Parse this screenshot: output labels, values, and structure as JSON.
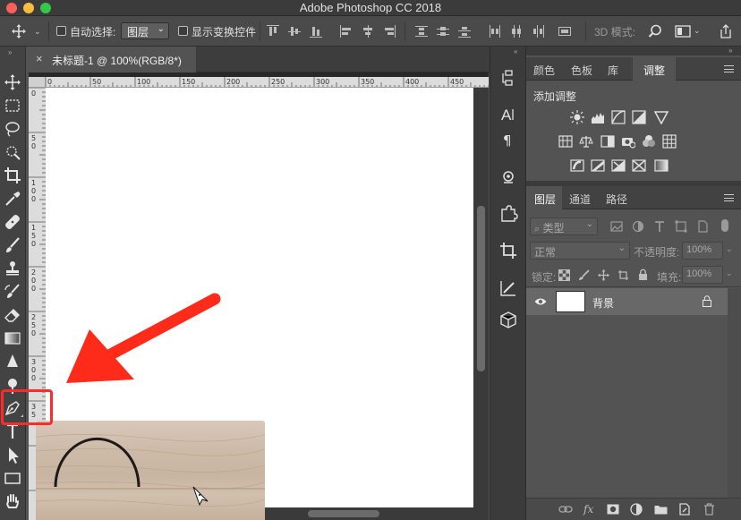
{
  "window": {
    "title": "Adobe Photoshop CC 2018"
  },
  "optionsbar": {
    "auto_select_label": "自动选择:",
    "auto_select_value": "图层",
    "show_transform_label": "显示变换控件",
    "mode_3d_label": "3D 模式:"
  },
  "document_tab": {
    "label": "未标题-1 @ 100%(RGB/8*)",
    "close_icon": "×"
  },
  "rulers": {
    "horizontal": [
      "0",
      "50",
      "100",
      "150",
      "200",
      "250",
      "300",
      "350",
      "400",
      "450"
    ],
    "vertical": [
      "0",
      "50",
      "100",
      "150",
      "200",
      "250",
      "300",
      "35"
    ]
  },
  "panel_top": {
    "tabs": [
      "颜色",
      "色板",
      "库",
      "调整"
    ],
    "active_tab": "调整",
    "add_adjustment_label": "添加调整"
  },
  "panel_layers": {
    "tabs": [
      "图层",
      "通道",
      "路径"
    ],
    "active_tab": "图层",
    "filter_label": "类型",
    "blend_mode": "正常",
    "opacity_label": "不透明度:",
    "opacity_value": "100%",
    "lock_label": "锁定:",
    "fill_label": "填充:",
    "fill_value": "100%",
    "layers": [
      {
        "name": "背景",
        "visible": true,
        "locked": true
      }
    ]
  },
  "colors": {
    "highlight": "#ff2b2b",
    "arrow": "#ff2b1a"
  }
}
